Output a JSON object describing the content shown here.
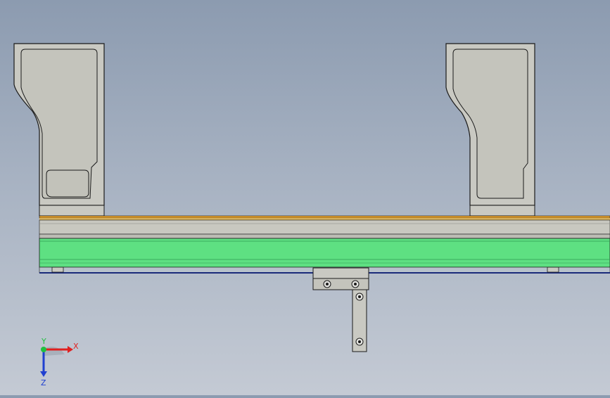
{
  "viewport": {
    "background_top": "#8c9bb0",
    "background_bottom": "#c4cad4",
    "part_fill": "#c9c9c2",
    "part_inner_fill": "#c4c4bc",
    "edge_color": "#1a1a1a",
    "rail_orange": "#e8a22b",
    "rail_green": "#5ee082",
    "base_edge_blue": "#1a2a7a"
  },
  "triad": {
    "x_label": "X",
    "y_label": "Y",
    "z_label": "Z",
    "x_color": "#e02020",
    "y_color": "#20c040",
    "z_color": "#2040d0"
  }
}
